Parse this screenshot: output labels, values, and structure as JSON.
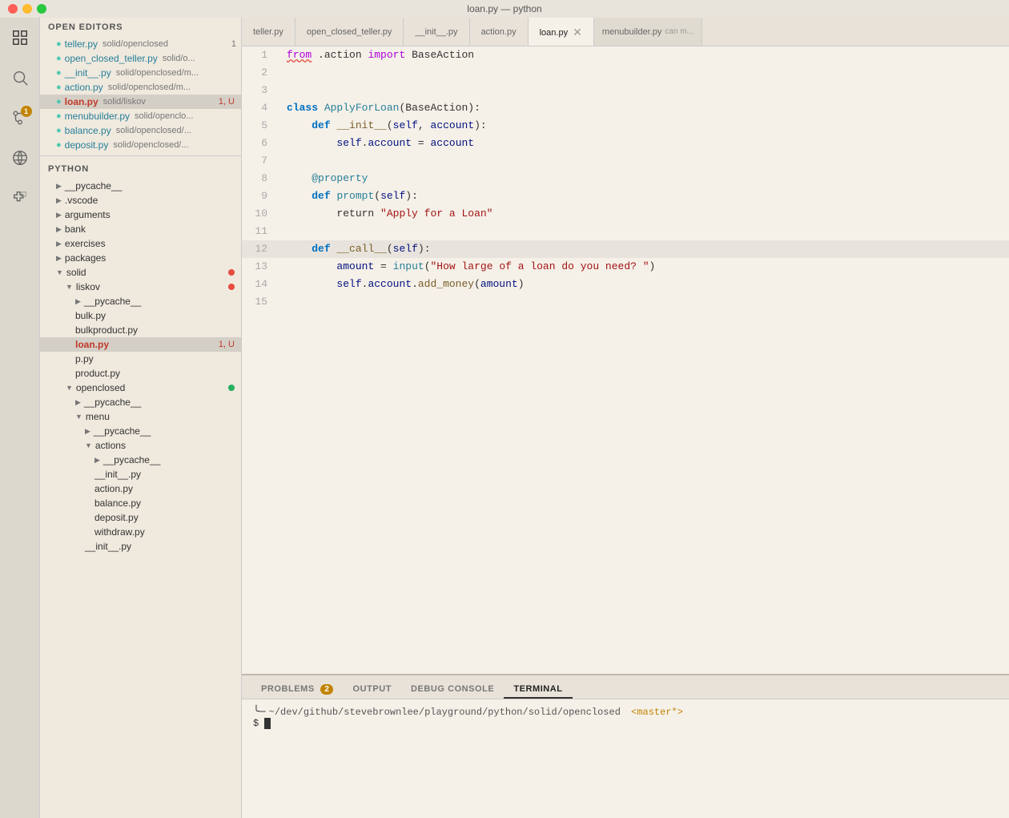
{
  "titlebar": {
    "title": "loan.py — python"
  },
  "activitybar": {
    "icons": [
      {
        "name": "explorer-icon",
        "symbol": "📁",
        "active": true
      },
      {
        "name": "search-icon",
        "symbol": "🔍",
        "active": false
      },
      {
        "name": "git-icon",
        "symbol": "⑂",
        "active": false,
        "badge": "1"
      },
      {
        "name": "debug-icon",
        "symbol": "⊘",
        "active": false
      },
      {
        "name": "extensions-icon",
        "symbol": "⊞",
        "active": false
      }
    ]
  },
  "sidebar": {
    "open_editors_header": "OPEN EDITORS",
    "python_header": "PYTHON",
    "open_editors": [
      {
        "name": "teller.py",
        "path": "solid/openclosed",
        "badge": "1",
        "badge_type": "number",
        "indent": "indent1"
      },
      {
        "name": "open_closed_teller.py",
        "path": "solid/o...",
        "indent": "indent1"
      },
      {
        "name": "__init__.py",
        "path": "solid/openclosed/m...",
        "indent": "indent1"
      },
      {
        "name": "action.py",
        "path": "solid/openclosed/m...",
        "indent": "indent1"
      },
      {
        "name": "loan.py",
        "path": "solid/liskov",
        "badge": "1, U",
        "badge_type": "red",
        "indent": "indent1",
        "active": true
      },
      {
        "name": "menubuilder.py",
        "path": "solid/openclo...",
        "indent": "indent1"
      },
      {
        "name": "balance.py",
        "path": "solid/openclosed/...",
        "indent": "indent1"
      },
      {
        "name": "deposit.py",
        "path": "solid/openclosed/...",
        "indent": "indent1"
      }
    ],
    "python_tree": [
      {
        "name": "__pycache__",
        "type": "folder",
        "indent": "indent1",
        "collapsed": true
      },
      {
        "name": ".vscode",
        "type": "folder",
        "indent": "indent1",
        "collapsed": true
      },
      {
        "name": "arguments",
        "type": "folder",
        "indent": "indent1",
        "collapsed": true
      },
      {
        "name": "bank",
        "type": "folder",
        "indent": "indent1",
        "collapsed": true
      },
      {
        "name": "exercises",
        "type": "folder",
        "indent": "indent1",
        "collapsed": true
      },
      {
        "name": "packages",
        "type": "folder",
        "indent": "indent1",
        "collapsed": true
      },
      {
        "name": "solid",
        "type": "folder",
        "indent": "indent1",
        "collapsed": false,
        "dot": "red"
      },
      {
        "name": "liskov",
        "type": "folder",
        "indent": "indent2",
        "collapsed": false,
        "dot": "red"
      },
      {
        "name": "__pycache__",
        "type": "folder",
        "indent": "indent3",
        "collapsed": true
      },
      {
        "name": "bulk.py",
        "type": "file",
        "indent": "indent3"
      },
      {
        "name": "bulkproduct.py",
        "type": "file",
        "indent": "indent3"
      },
      {
        "name": "loan.py",
        "type": "file",
        "indent": "indent3",
        "badge": "1, U",
        "badge_type": "red",
        "active": true
      },
      {
        "name": "p.py",
        "type": "file",
        "indent": "indent3"
      },
      {
        "name": "product.py",
        "type": "file",
        "indent": "indent3"
      },
      {
        "name": "openclosed",
        "type": "folder",
        "indent": "indent2",
        "collapsed": false,
        "dot": "green"
      },
      {
        "name": "__pycache__",
        "type": "folder",
        "indent": "indent3",
        "collapsed": true
      },
      {
        "name": "menu",
        "type": "folder",
        "indent": "indent3",
        "collapsed": false
      },
      {
        "name": "__pycache__",
        "type": "folder",
        "indent": "indent4",
        "collapsed": true
      },
      {
        "name": "actions",
        "type": "folder",
        "indent": "indent4",
        "collapsed": false
      },
      {
        "name": "__pycache__",
        "type": "folder",
        "indent": "indent5",
        "collapsed": true
      },
      {
        "name": "__init__.py",
        "type": "file",
        "indent": "indent5"
      },
      {
        "name": "action.py",
        "type": "file",
        "indent": "indent5"
      },
      {
        "name": "balance.py",
        "type": "file",
        "indent": "indent5"
      },
      {
        "name": "deposit.py",
        "type": "file",
        "indent": "indent5"
      },
      {
        "name": "withdraw.py",
        "type": "file",
        "indent": "indent5"
      },
      {
        "name": "__init__.py",
        "type": "file",
        "indent": "indent4"
      }
    ]
  },
  "tabs": [
    {
      "label": "teller.py",
      "active": false
    },
    {
      "label": "open_closed_teller.py",
      "active": false
    },
    {
      "label": "__init__.py",
      "active": false
    },
    {
      "label": "action.py",
      "active": false
    },
    {
      "label": "loan.py",
      "active": true,
      "closeable": true
    },
    {
      "label": "menubuilder.py",
      "active": false,
      "overflow": true
    }
  ],
  "code": {
    "lines": [
      {
        "num": 1,
        "content": "from .action import BaseAction",
        "highlighted": false
      },
      {
        "num": 2,
        "content": "",
        "highlighted": false
      },
      {
        "num": 3,
        "content": "",
        "highlighted": false
      },
      {
        "num": 4,
        "content": "class ApplyForLoan(BaseAction):",
        "highlighted": false
      },
      {
        "num": 5,
        "content": "    def __init__(self, account):",
        "highlighted": false
      },
      {
        "num": 6,
        "content": "        self.account = account",
        "highlighted": false
      },
      {
        "num": 7,
        "content": "",
        "highlighted": false
      },
      {
        "num": 8,
        "content": "    @property",
        "highlighted": false
      },
      {
        "num": 9,
        "content": "    def prompt(self):",
        "highlighted": false
      },
      {
        "num": 10,
        "content": "        return \"Apply for a Loan\"",
        "highlighted": false
      },
      {
        "num": 11,
        "content": "",
        "highlighted": false
      },
      {
        "num": 12,
        "content": "    def __call__(self):",
        "highlighted": true
      },
      {
        "num": 13,
        "content": "        amount = input(\"How large of a loan do you need? \")",
        "highlighted": false
      },
      {
        "num": 14,
        "content": "        self.account.add_money(amount)",
        "highlighted": false
      },
      {
        "num": 15,
        "content": "",
        "highlighted": false
      }
    ]
  },
  "bottom_panel": {
    "tabs": [
      {
        "label": "PROBLEMS",
        "badge": "2",
        "active": false
      },
      {
        "label": "OUTPUT",
        "active": false
      },
      {
        "label": "DEBUG CONSOLE",
        "active": false
      },
      {
        "label": "TERMINAL",
        "active": true
      }
    ],
    "terminal": {
      "path": "~/dev/github/stevebrownlee/playground/python/solid/openclosed",
      "branch": "<master*>",
      "prompt": "$"
    }
  }
}
